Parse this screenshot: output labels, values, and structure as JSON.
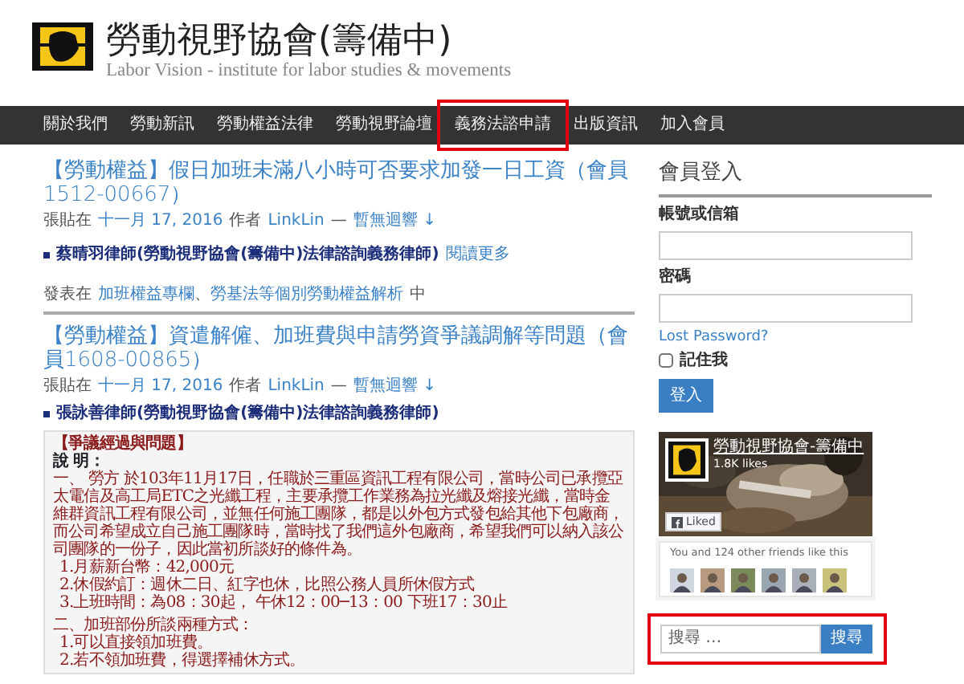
{
  "site": {
    "title": "勞動視野協會(籌備中)",
    "subtitle": "Labor Vision - institute for labor studies & movements"
  },
  "nav": {
    "items": [
      {
        "label": "關於我們",
        "highlighted": false
      },
      {
        "label": "勞動新訊",
        "highlighted": false
      },
      {
        "label": "勞動權益法律",
        "highlighted": false
      },
      {
        "label": "勞動視野論壇",
        "highlighted": false
      },
      {
        "label": "義務法諮申請",
        "highlighted": true
      },
      {
        "label": "出版資訊",
        "highlighted": false
      },
      {
        "label": "加入會員",
        "highlighted": false
      }
    ]
  },
  "posts": [
    {
      "title": "【勞動權益】假日加班未滿八小時可否要求加發一日工資（會員1512-00667）",
      "meta": {
        "posted": "張貼在",
        "date": "十一月 17, 2016",
        "by": "作者",
        "author": "LinkLin",
        "dash": "—",
        "comments": "暫無迴響 ↓"
      },
      "lawyer": "蔡晴羽律師(勞動視野協會(籌備中)法律諮詢義務律師)",
      "more": "閱讀更多",
      "categories": {
        "prefix": "發表在",
        "links": [
          "加班權益專欄",
          "勞基法等個別勞動權益解析"
        ],
        "sep": "、",
        "suffix": "中"
      }
    },
    {
      "title": "【勞動權益】資遣解僱、加班費與申請勞資爭議調解等問題（會員1608-00865）",
      "meta": {
        "posted": "張貼在",
        "date": "十一月 17, 2016",
        "by": "作者",
        "author": "LinkLin",
        "dash": "—",
        "comments": "暫無迴響 ↓"
      },
      "lawyer": "張詠善律師(勞動視野協會(籌備中)法律諮詢義務律師)",
      "box": {
        "heading": "【爭議經過與問題】",
        "lines": [
          {
            "kind": "label",
            "text": "說 明："
          },
          {
            "kind": "para",
            "text": "一、 勞方 於103年11月17日，任職於三重區資訊工程有限公司，當時公司已承攬亞太電信及高工局ETC之光纖工程，主要承攬工作業務為拉光纖及熔接光纖，當時金維群資訊工程有限公司，並無任何施工團隊，都是以外包方式發包給其他下包廠商，而公司希望成立自己施工團隊時，當時找了我們這外包廠商，希望我們可以納入該公司團隊的一份子，因此當初所談好的條件為。"
          },
          {
            "kind": "item",
            "text": "1.月薪新台幣：42,000元"
          },
          {
            "kind": "item",
            "text": "2.休假約訂：週休二日、紅字也休，比照公務人員所休假方式"
          },
          {
            "kind": "item",
            "text": "3.上班時間：為08：30起， 午休12：00─13：00 下班17：30止"
          },
          {
            "kind": "section",
            "text": "二、加班部份所談兩種方式："
          },
          {
            "kind": "item",
            "text": "1.可以直接領加班費。"
          },
          {
            "kind": "item",
            "text": "2.若不領加班費，得選擇補休方式。"
          }
        ]
      }
    }
  ],
  "login": {
    "title": "會員登入",
    "user_label": "帳號或信箱",
    "password_label": "密碼",
    "lost": "Lost Password?",
    "remember": "記住我",
    "remember_checked": false,
    "button": "登入"
  },
  "facebook": {
    "page_name": "勞動視野協會-籌備中",
    "likes": "1.8K likes",
    "liked": "Liked",
    "friends": "You and 124 other friends like this"
  },
  "search": {
    "placeholder": "搜尋 …",
    "button": "搜尋",
    "highlighted": true
  }
}
